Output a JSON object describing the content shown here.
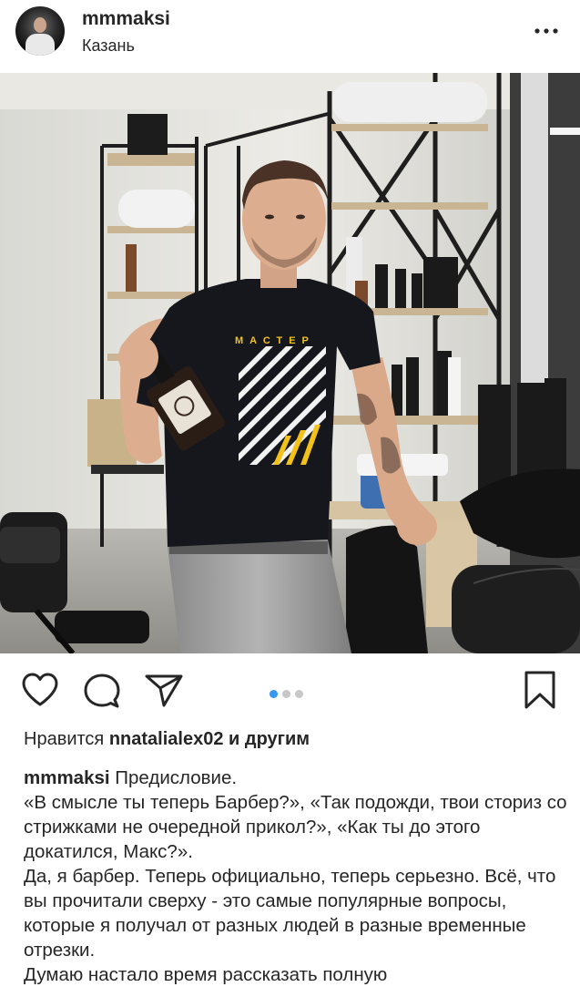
{
  "header": {
    "username": "mmmaksi",
    "location": "Казань"
  },
  "post": {
    "photo_shirt_text": "МАСТЕР",
    "carousel": {
      "count": 3,
      "active_index": 1
    },
    "likes": {
      "prefix": "Нравится",
      "user": "nnatalialex02",
      "suffix": "и другим"
    },
    "caption": {
      "username": "mmmaksi",
      "lines": [
        "Предисловие.",
        "«В смысле ты теперь Барбер?», «Так подожди, твои сториз со стрижками не очередной прикол?», «Как ты до этого докатился, Макс?».",
        "Да, я барбер. Теперь официально, теперь серьезно. Всё, что вы прочитали сверху - это самые популярные вопросы, которые я получал от разных людей в разные временные отрезки.",
        "Думаю настало время рассказать полную"
      ]
    }
  },
  "icons": {
    "like": "heart-icon",
    "comment": "comment-icon",
    "share": "send-icon",
    "save": "bookmark-icon",
    "more": "more-icon"
  },
  "colors": {
    "text": "#262626",
    "carousel_active": "#3897f0",
    "carousel_inactive": "#c7c7c7"
  }
}
